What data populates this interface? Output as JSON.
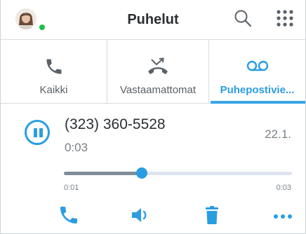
{
  "header": {
    "title": "Puhelut",
    "presence_color": "#1fbf4a",
    "icons": [
      "avatar",
      "search-icon",
      "grid-menu-icon"
    ]
  },
  "tabs": [
    {
      "label": "Kaikki",
      "icon": "phone-icon",
      "active": false
    },
    {
      "label": "Vastaamattomat",
      "icon": "missed-call-icon",
      "active": false
    },
    {
      "label": "Puhepostivie...",
      "icon": "voicemail-icon",
      "active": true
    }
  ],
  "voicemail": {
    "number": "(323) 360-5528",
    "duration": "0:03",
    "date": "22.1.",
    "progress_fraction": 0.34,
    "time_elapsed": "0:01",
    "time_total": "0:03"
  },
  "actions": [
    "call-icon",
    "speaker-icon",
    "trash-icon",
    "more-icon"
  ],
  "colors": {
    "accent": "#2a9de2",
    "text": "#2b2f33",
    "muted": "#7a8187",
    "divider": "#d7dadd"
  }
}
